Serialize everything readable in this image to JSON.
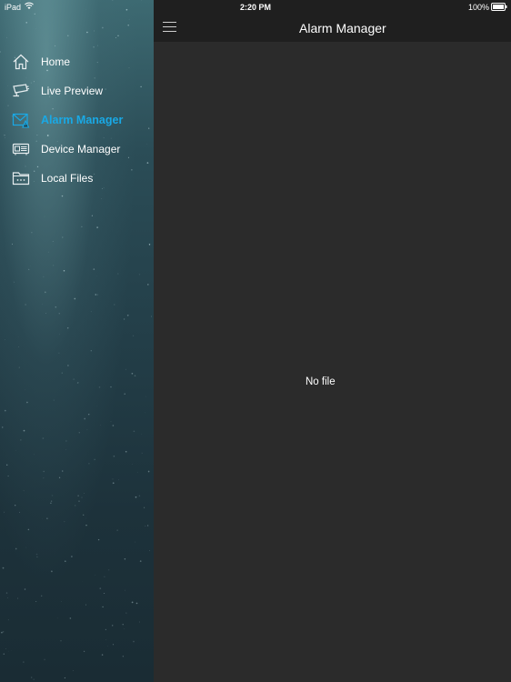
{
  "status_bar": {
    "device": "iPad",
    "time": "2:20 PM",
    "battery": "100%"
  },
  "sidebar": {
    "items": [
      {
        "label": "Home",
        "icon": "home-icon",
        "active": false
      },
      {
        "label": "Live Preview",
        "icon": "camera-icon",
        "active": false
      },
      {
        "label": "Alarm Manager",
        "icon": "alarm-mail-icon",
        "active": true
      },
      {
        "label": "Device Manager",
        "icon": "device-icon",
        "active": false
      },
      {
        "label": "Local Files",
        "icon": "folder-icon",
        "active": false
      }
    ]
  },
  "header": {
    "title": "Alarm Manager"
  },
  "content": {
    "empty_message": "No file"
  },
  "colors": {
    "accent": "#19a9e6",
    "main_bg": "#2b2b2b",
    "topbar_bg": "#1f1f1f"
  }
}
